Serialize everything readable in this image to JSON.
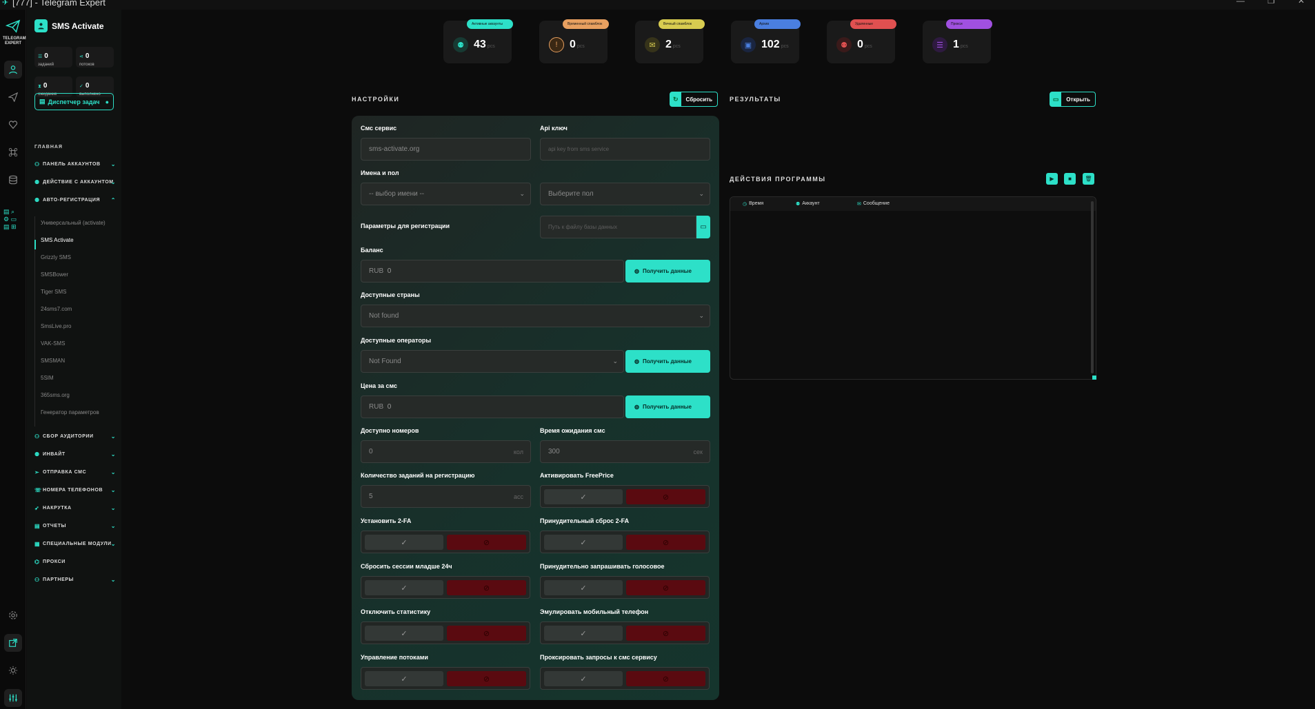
{
  "window": {
    "title": "[777] - Telegram Expert",
    "controls": [
      "minimize",
      "maximize",
      "close"
    ]
  },
  "rail": {
    "logo_line1": "TELEGRAM",
    "logo_line2": "EXPERT",
    "items": [
      "user-icon",
      "send-icon",
      "heart-icon",
      "command-icon",
      "database-icon"
    ],
    "bottom": [
      "settings-icon",
      "external-icon",
      "theme-icon",
      "sliders-icon"
    ]
  },
  "sidebar": {
    "title": "SMS Activate",
    "stats": [
      {
        "value": "0",
        "label": "заданий"
      },
      {
        "value": "0",
        "label": "потоков"
      },
      {
        "value": "0",
        "label": "ожидание"
      },
      {
        "value": "0",
        "label": "выполнено"
      }
    ],
    "dispatcher": "Диспетчер задач",
    "section": "ГЛАВНАЯ",
    "nav_top": [
      {
        "label": "ПАНЕЛЬ АККАУНТОВ"
      },
      {
        "label": "ДЕЙСТВИЕ С АККАУНТОМ"
      },
      {
        "label": "АВТО-РЕГИСТРАЦИЯ"
      }
    ],
    "subitems": [
      "Универсальный (activate)",
      "SMS Activate",
      "Grizzly SMS",
      "SMSBower",
      "Tiger SMS",
      "24sms7.com",
      "SmsLive.pro",
      "VAK-SMS",
      "SMSMAN",
      "5SIM",
      "365sms.org",
      "Генератор параметров"
    ],
    "nav_bottom": [
      {
        "label": "СБОР АУДИТОРИИ",
        "chev": true
      },
      {
        "label": "ИНВАЙТ",
        "chev": true
      },
      {
        "label": "ОТПРАВКА СМС",
        "chev": true
      },
      {
        "label": "НОМЕРА ТЕЛЕФОНОВ",
        "chev": true
      },
      {
        "label": "НАКРУТКА",
        "chev": true
      },
      {
        "label": "ОТЧЕТЫ",
        "chev": true
      },
      {
        "label": "СПЕЦИАЛЬНЫЕ МОДУЛИ",
        "chev": true
      },
      {
        "label": "ПРОКСИ",
        "chev": false
      },
      {
        "label": "ПАРТНЕРЫ",
        "chev": true
      }
    ]
  },
  "top_stats": [
    {
      "badge": "Активные аккаунты",
      "value": "43",
      "unit": "pcs",
      "color": "#2de0c8"
    },
    {
      "badge": "Временный спамблок",
      "value": "0",
      "unit": "pcs",
      "color": "#e8a060"
    },
    {
      "badge": "Вечный спамблок",
      "value": "2",
      "unit": "pcs",
      "color": "#d8cc50"
    },
    {
      "badge": "Архив",
      "value": "102",
      "unit": "pcs",
      "color": "#4a7fe0"
    },
    {
      "badge": "Удаленные",
      "value": "0",
      "unit": "pcs",
      "color": "#e05050"
    },
    {
      "badge": "Прокси",
      "value": "1",
      "unit": "pcs",
      "color": "#a050e0"
    }
  ],
  "settings": {
    "title": "НАСТРОЙКИ",
    "reset": "Сбросить",
    "sms_service_label": "Смс сервис",
    "sms_service_value": "sms-activate.org",
    "api_key_label": "Api ключ",
    "api_key_placeholder": "api key from sms service",
    "names_label": "Имена и пол",
    "names_value": "-- выбор имени --",
    "gender_value": "Выберите пол",
    "reg_params_label": "Параметры для регистрации",
    "reg_params_placeholder": "Путь к файлу базы данных",
    "balance_label": "Баланс",
    "currency": "RUB",
    "balance_value": "0",
    "get_data": "Получить данные",
    "countries_label": "Доступные страны",
    "countries_value": "Not found",
    "operators_label": "Доступные операторы",
    "operators_value": "Not Found",
    "price_label": "Цена за смс",
    "price_value": "0",
    "numbers_label": "Доступно номеров",
    "numbers_value": "0",
    "numbers_unit": "кол",
    "wait_label": "Время ожидания смс",
    "wait_value": "300",
    "wait_unit": "сек",
    "tasks_label": "Количество заданий на регистрацию",
    "tasks_value": "5",
    "tasks_unit": "acc",
    "toggles": [
      "Активировать FreePrice",
      "Установить 2-FA",
      "Принудительный сброс 2-FA",
      "Сбросить сессии младше 24ч",
      "Принудительно запрашивать голосовое",
      "Отключить статистику",
      "Эмулировать мобильный телефон",
      "Управление потоками",
      "Проксировать запросы к смс сервису"
    ]
  },
  "results": {
    "title": "РЕЗУЛЬТАТЫ",
    "open": "Открыть"
  },
  "actions": {
    "title": "ДЕЙСТВИЯ ПРОГРАММЫ",
    "columns": [
      "Время",
      "Аккаунт",
      "Сообщение"
    ]
  }
}
